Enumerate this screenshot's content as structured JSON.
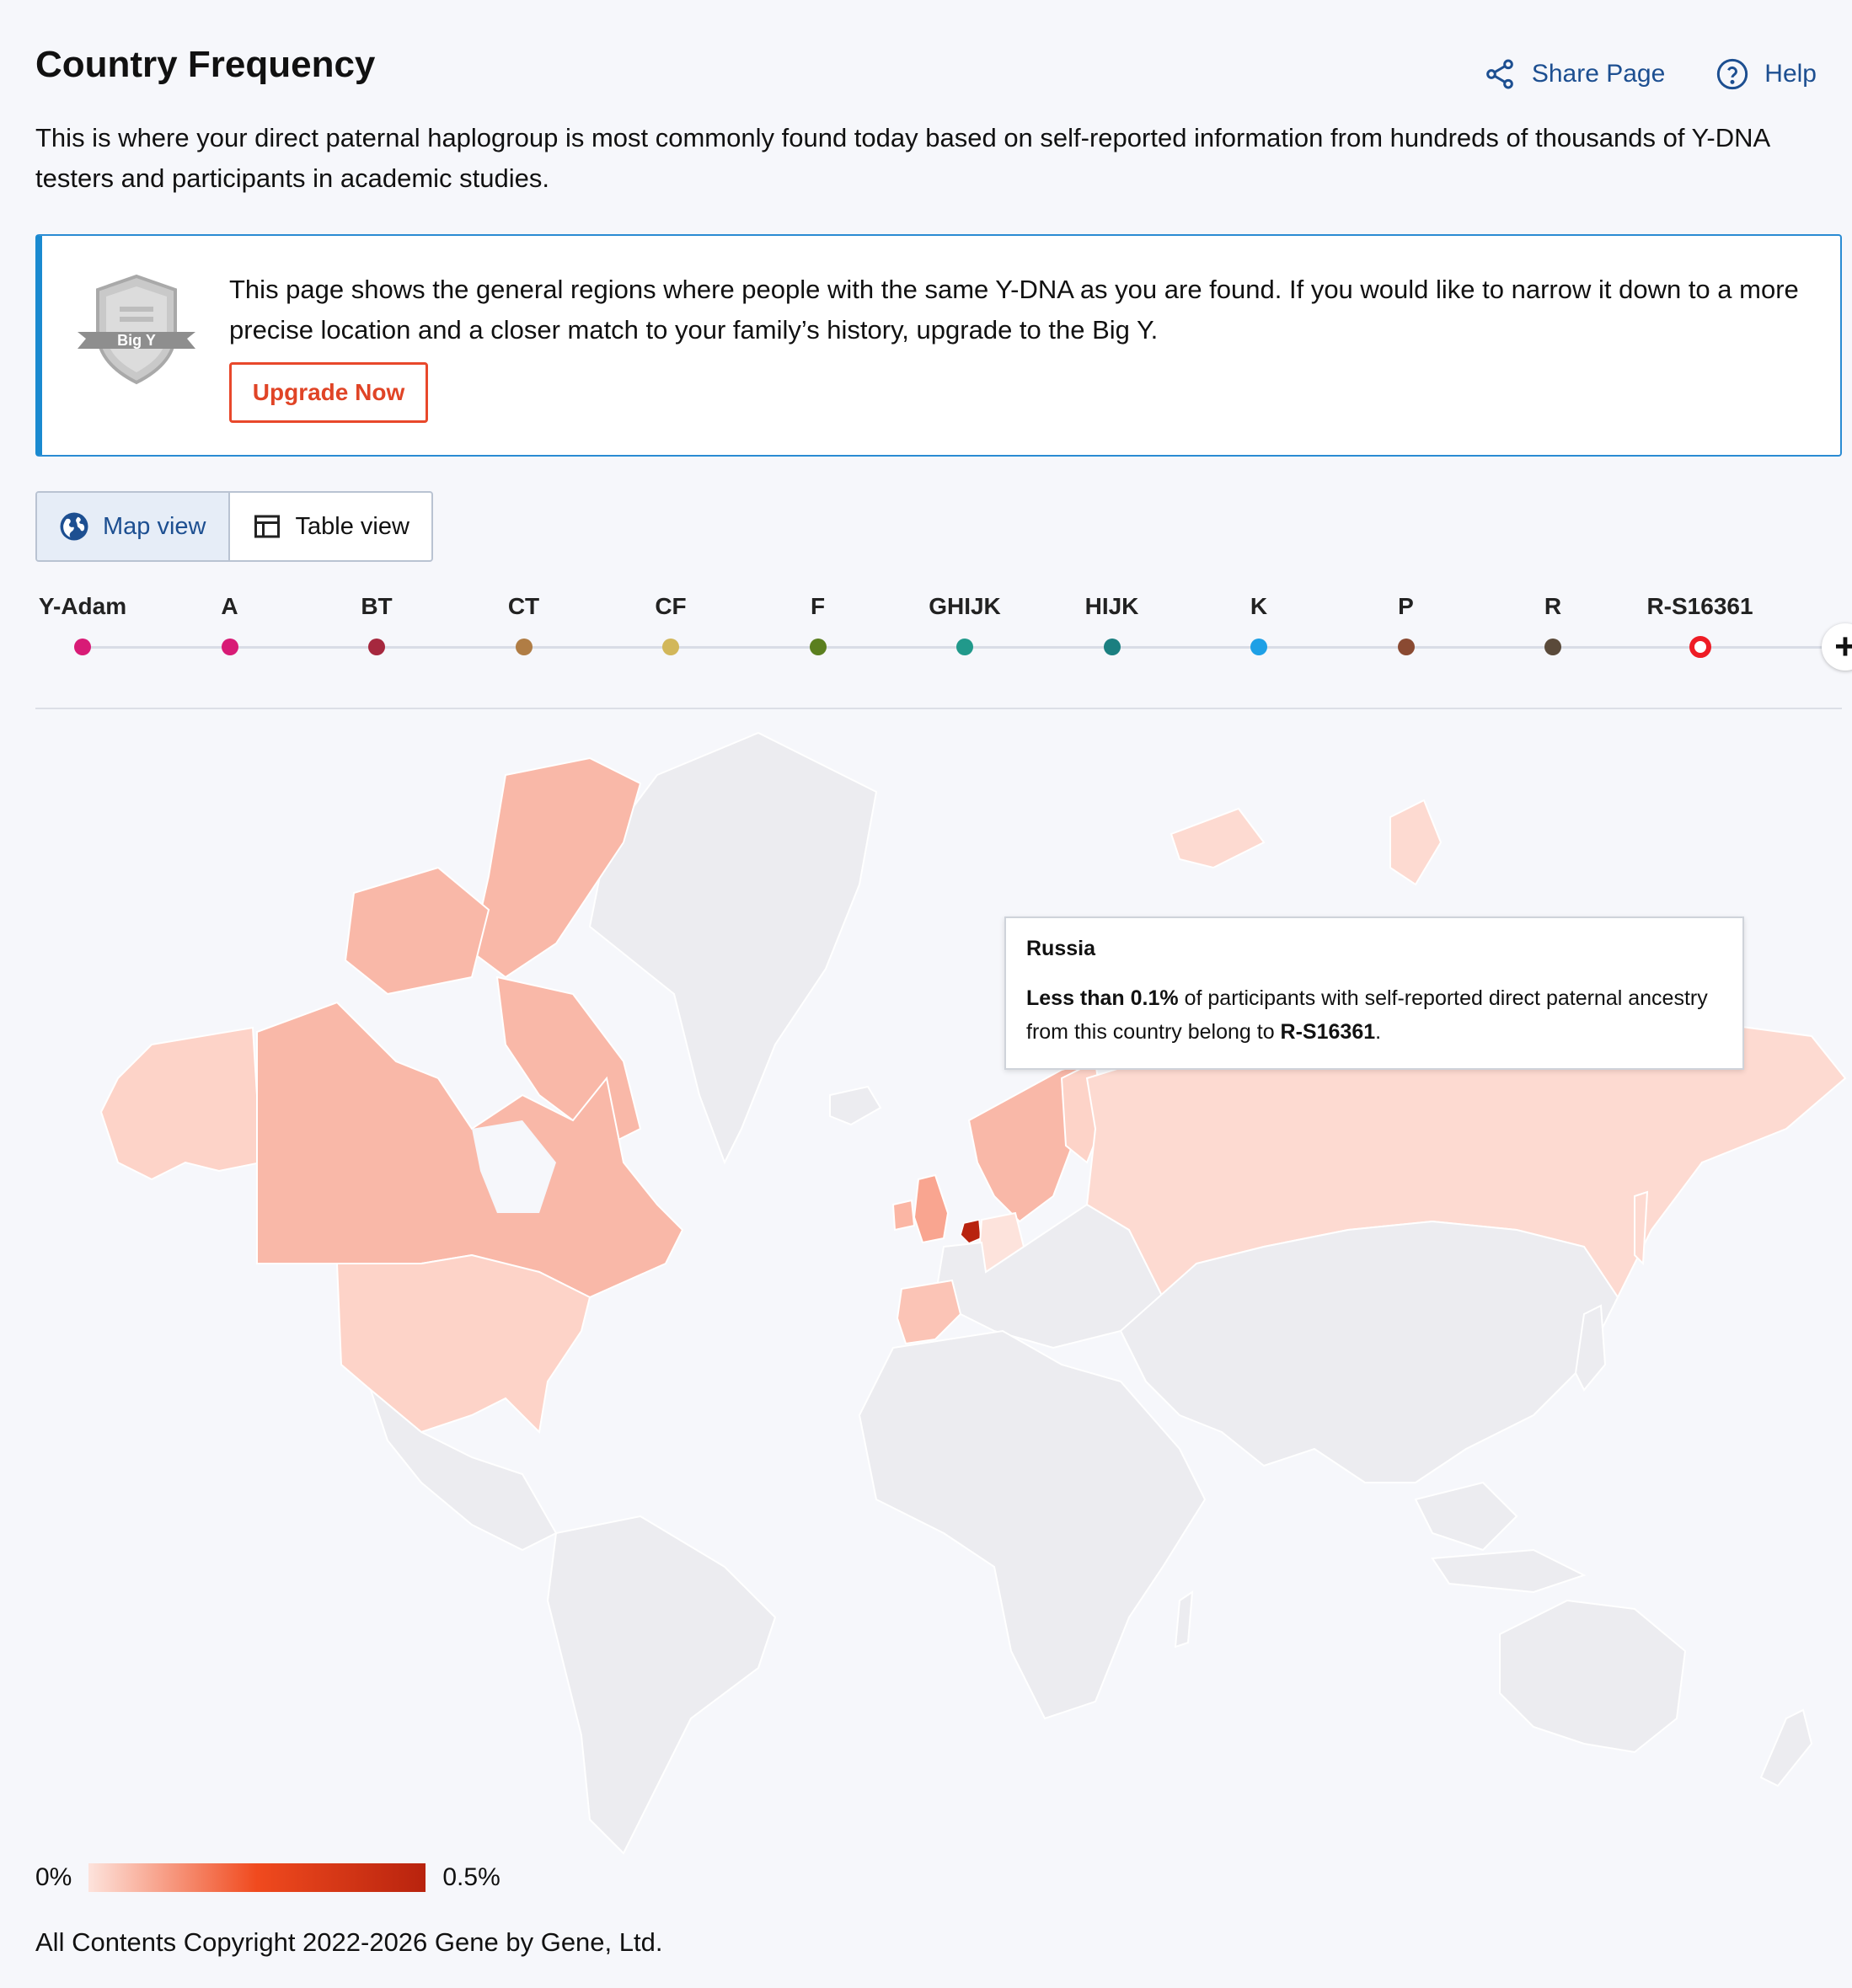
{
  "header": {
    "title": "Country Frequency",
    "share_label": "Share Page",
    "help_label": "Help"
  },
  "intro": "This is where your direct paternal haplogroup is most commonly found today based on self-reported information from hundreds of thousands of Y-DNA testers and participants in academic studies.",
  "banner": {
    "badge_text": "Big Y",
    "text": "This page shows the general regions where people with the same Y-DNA as you are found. If you would like to narrow it down to a more precise location and a closer match to your family’s history, upgrade to the Big Y.",
    "button_label": "Upgrade Now"
  },
  "view_toggle": {
    "map_label": "Map view",
    "table_label": "Table view",
    "active": "map"
  },
  "timeline": [
    {
      "label": "Y-Adam",
      "color": "#d81b76"
    },
    {
      "label": "A",
      "color": "#d81b76"
    },
    {
      "label": "BT",
      "color": "#a6283e"
    },
    {
      "label": "CT",
      "color": "#b07d45"
    },
    {
      "label": "CF",
      "color": "#d2b75a"
    },
    {
      "label": "F",
      "color": "#5b7f1f"
    },
    {
      "label": "GHIJK",
      "color": "#21998b"
    },
    {
      "label": "HIJK",
      "color": "#1b7f80"
    },
    {
      "label": "K",
      "color": "#1ea0e6"
    },
    {
      "label": "P",
      "color": "#8a4a32"
    },
    {
      "label": "R",
      "color": "#5a4a3a"
    },
    {
      "label": "R-S16361",
      "color": "#ee1c25",
      "current": true
    }
  ],
  "tooltip": {
    "country": "Russia",
    "strong1": "Less than 0.1%",
    "text1": " of participants with self-reported direct paternal ancestry from this country belong to ",
    "strong2": "R-S16361",
    "text2": "."
  },
  "legend": {
    "min_label": "0%",
    "max_label": "0.5%",
    "color_low": "#fde3dc",
    "color_mid": "#f04a1e",
    "color_high": "#b8230e"
  },
  "footer": {
    "copyright": "All Contents Copyright 2022-2026 Gene by Gene, Ltd."
  }
}
